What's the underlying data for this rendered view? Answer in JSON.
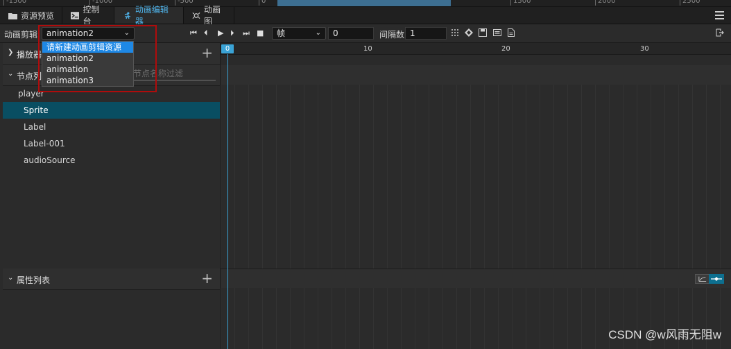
{
  "ruler": {
    "ticks": [
      "-1500",
      "-1000",
      "-500",
      "0",
      "1500",
      "2000",
      "2500"
    ]
  },
  "tabs": [
    {
      "label": "资源预览",
      "icon": "folder-icon"
    },
    {
      "label": "控制台",
      "icon": "console-icon"
    },
    {
      "label": "动画编辑器",
      "icon": "animation-icon",
      "active": true
    },
    {
      "label": "动画图",
      "icon": "animation-graph-icon"
    }
  ],
  "toolbar": {
    "clip_label": "动画剪辑",
    "clip_select": "animation2",
    "mode_select": "帧",
    "frame_value": "0",
    "interval_label": "间隔数",
    "interval_value": "1"
  },
  "dropdown": {
    "options": [
      "请新建动画剪辑资源",
      "animation2",
      "animation",
      "animation3"
    ],
    "highlighted_index": 0
  },
  "left": {
    "playback_section": "播放器",
    "node_section": "节点列表",
    "filter_placeholder": "节点名称过滤",
    "nodes": [
      "player",
      "Sprite",
      "Label",
      "Label-001",
      "audioSource"
    ],
    "selected_node": "Sprite",
    "property_section": "属性列表"
  },
  "timeline": {
    "current_frame": "0",
    "ticks": [
      "10",
      "20",
      "30"
    ],
    "accent": "#3aa3d6"
  },
  "watermark": "CSDN @w风雨无阻w"
}
